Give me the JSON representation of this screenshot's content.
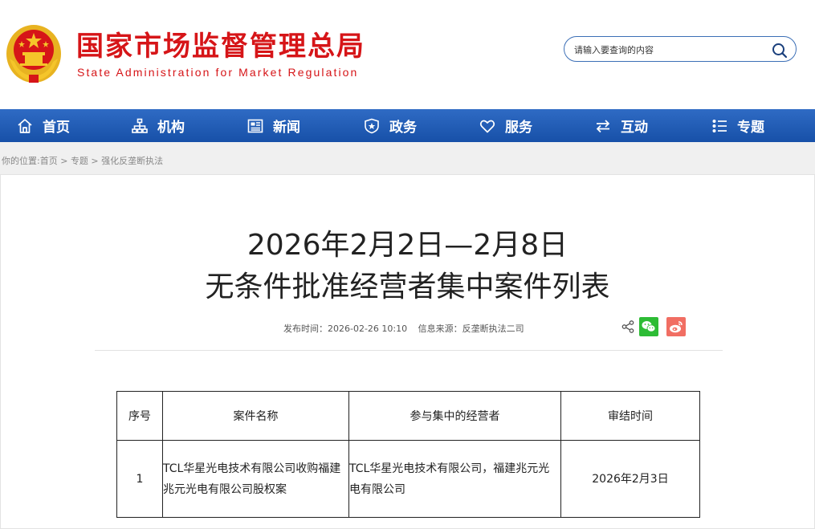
{
  "header": {
    "title_cn": "国家市场监督管理总局",
    "title_en": "State Administration for Market Regulation",
    "search_placeholder": "请输入要查询的内容"
  },
  "nav": [
    {
      "label": "首页",
      "icon": "home-icon"
    },
    {
      "label": "机构",
      "icon": "org-chart-icon"
    },
    {
      "label": "新闻",
      "icon": "news-icon"
    },
    {
      "label": "政务",
      "icon": "government-shield-icon"
    },
    {
      "label": "服务",
      "icon": "heart-icon"
    },
    {
      "label": "互动",
      "icon": "exchange-arrows-icon"
    },
    {
      "label": "专题",
      "icon": "topic-list-icon"
    }
  ],
  "breadcrumb": {
    "prefix": "你的位置:",
    "items": [
      "首页",
      "专题",
      "强化反垄断执法"
    ],
    "separator": " > "
  },
  "article": {
    "title_line1": "2026年2月2日—2月8日",
    "title_line2": "无条件批准经营者集中案件列表",
    "publish_label": "发布时间：",
    "publish_time": "2026-02-26 10:10",
    "source_label": "信息来源：",
    "source": "反垄断执法二司"
  },
  "share": {
    "icons": [
      "share-icon",
      "wechat-icon",
      "weibo-icon"
    ],
    "colors": {
      "wechat": "#2dbc35",
      "weibo": "#f16e63"
    }
  },
  "table": {
    "headers": [
      "序号",
      "案件名称",
      "参与集中的经营者",
      "审结时间"
    ],
    "rows": [
      [
        "1",
        "TCL华星光电技术有限公司收购福建兆元光电有限公司股权案",
        "TCL华星光电技术有限公司，福建兆元光电有限公司",
        "2026年2月3日"
      ]
    ]
  },
  "colors": {
    "brand_red": "#d61518",
    "nav_blue": "#1f5bb5"
  }
}
